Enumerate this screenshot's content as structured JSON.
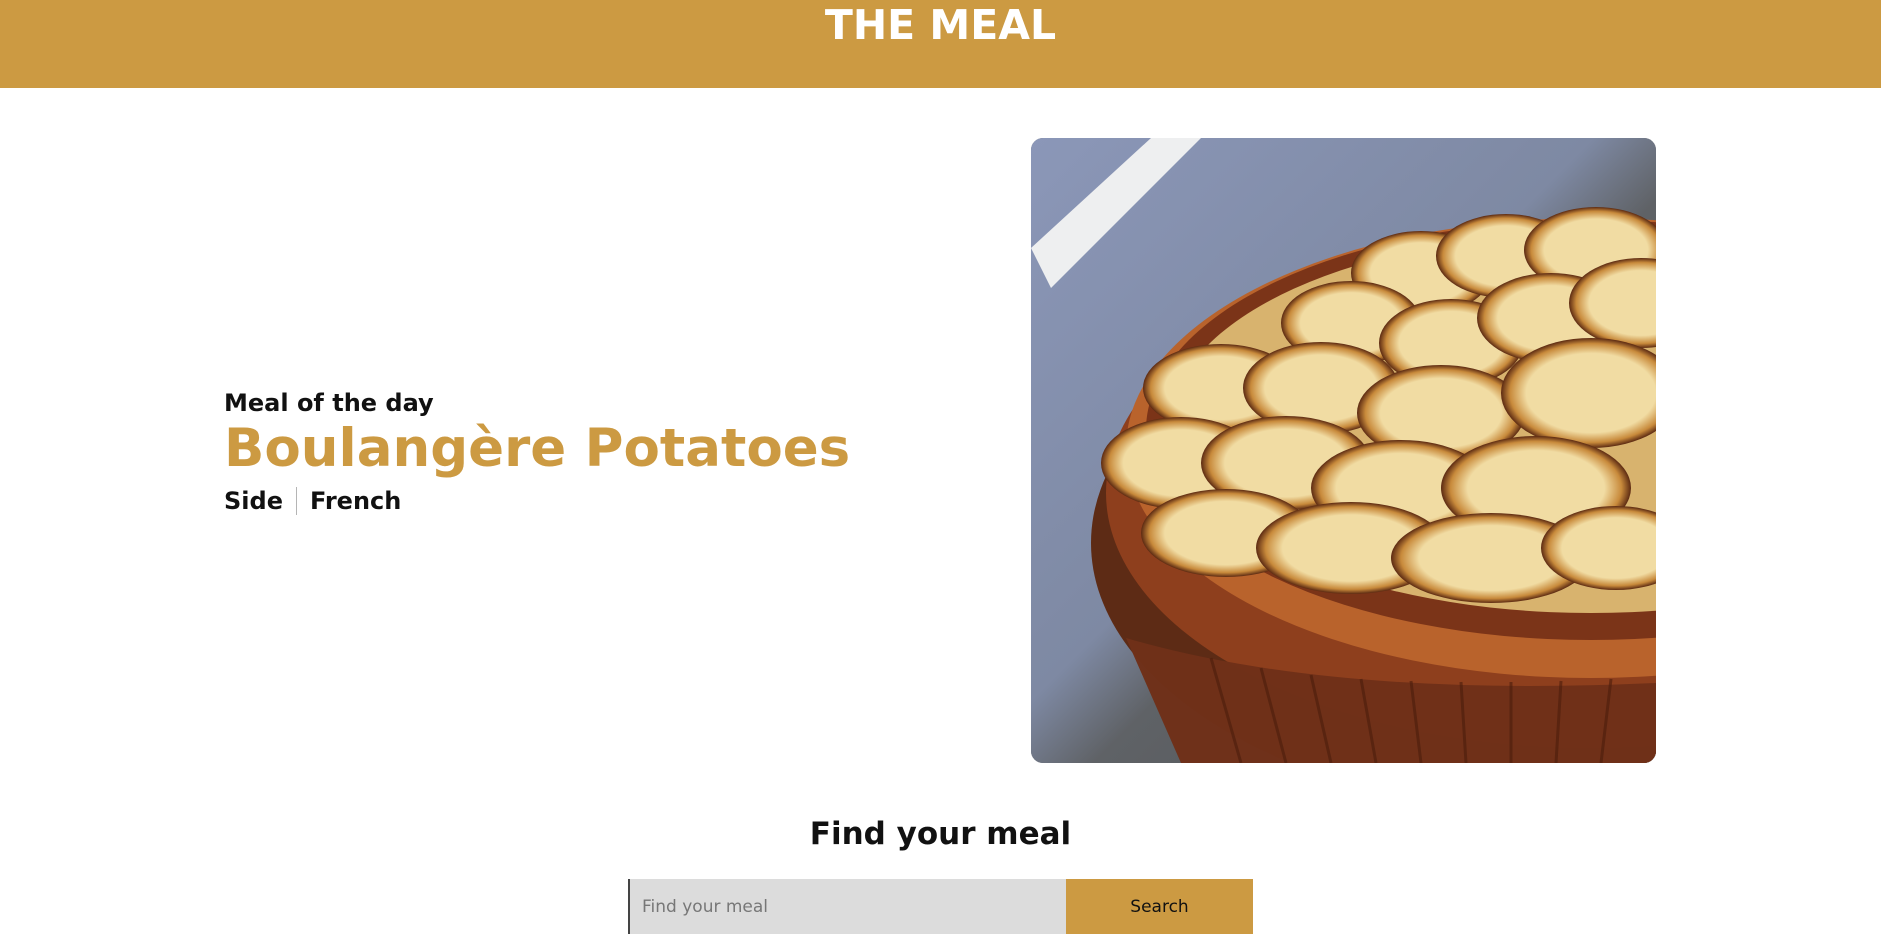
{
  "header": {
    "title": "THE MEAL"
  },
  "meal_of_the_day": {
    "eyebrow": "Meal of the day",
    "name": "Boulangère Potatoes",
    "category": "Side",
    "area": "French",
    "image_icon": "potato-gratin-dish-photo"
  },
  "search": {
    "title": "Find your meal",
    "placeholder": "Find your meal",
    "value": "",
    "button_label": "Search"
  },
  "colors": {
    "accent": "#cc9a42",
    "text": "#111111",
    "input_bg": "#dcdcdc"
  }
}
